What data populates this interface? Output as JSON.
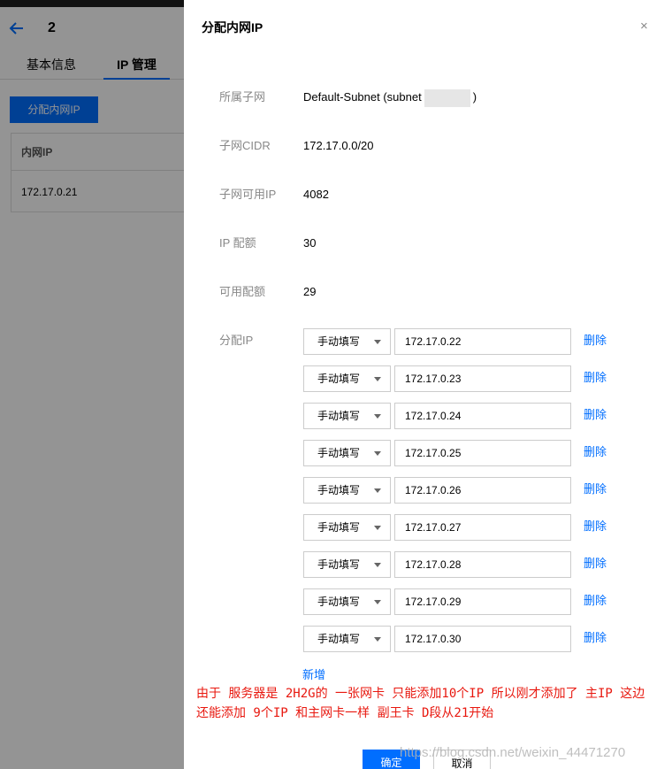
{
  "background": {
    "page_number": "2",
    "tabs": [
      {
        "label": "基本信息"
      },
      {
        "label": "IP 管理"
      }
    ],
    "assign_button": "分配内网IP",
    "table": {
      "header": "内网IP",
      "rows": [
        "172.17.0.21"
      ]
    }
  },
  "drawer": {
    "title": "分配内网IP",
    "close": "×",
    "subnet": {
      "label": "所属子网",
      "value_prefix": "Default-Subnet (subnet",
      "value_suffix": ")"
    },
    "cidr": {
      "label": "子网CIDR",
      "value": "172.17.0.0/20"
    },
    "available_ips": {
      "label": "子网可用IP",
      "value": "4082"
    },
    "ip_quota": {
      "label": "IP 配额",
      "value": "30"
    },
    "available_quota": {
      "label": "可用配额",
      "value": "29"
    },
    "assign_ip_label": "分配IP",
    "mode_label": "手动填写",
    "delete_label": "删除",
    "ips": [
      "172.17.0.22",
      "172.17.0.23",
      "172.17.0.24",
      "172.17.0.25",
      "172.17.0.26",
      "172.17.0.27",
      "172.17.0.28",
      "172.17.0.29",
      "172.17.0.30"
    ],
    "add_label": "新增",
    "note": "由于 服务器是 2H2G的 一张网卡 只能添加10个IP 所以刚才添加了 主IP 这边还能添加 9个IP 和主网卡一样 副王卡 D段从21开始",
    "confirm": "确定",
    "cancel": "取消",
    "watermark": "https://blog.csdn.net/weixin_44471270"
  },
  "colors": {
    "accent": "#006eff",
    "note": "#e8180f"
  }
}
